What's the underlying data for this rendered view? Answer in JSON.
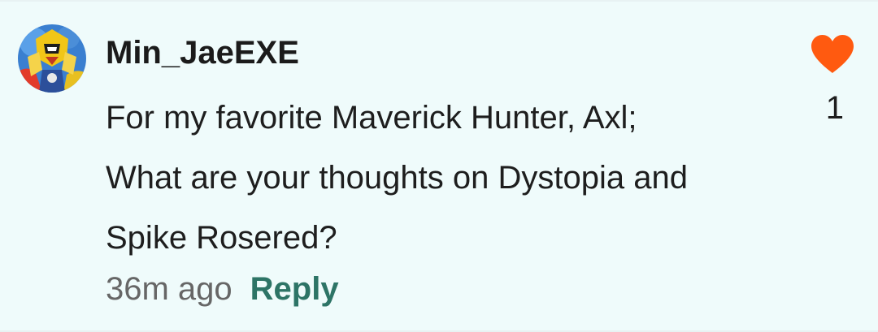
{
  "comment": {
    "username": "Min_JaeEXE",
    "body_lines": [
      "For my favorite Maverick Hunter, Axl;",
      "What are your thoughts on Dystopia and",
      "Spike Rosered?"
    ],
    "time_ago": "36m ago",
    "reply_label": "Reply",
    "like_count": "1",
    "like_icon": "heart-icon",
    "colors": {
      "background": "#effbfb",
      "heart": "#ff5a10",
      "reply": "#2d7466",
      "time": "#666666"
    }
  }
}
